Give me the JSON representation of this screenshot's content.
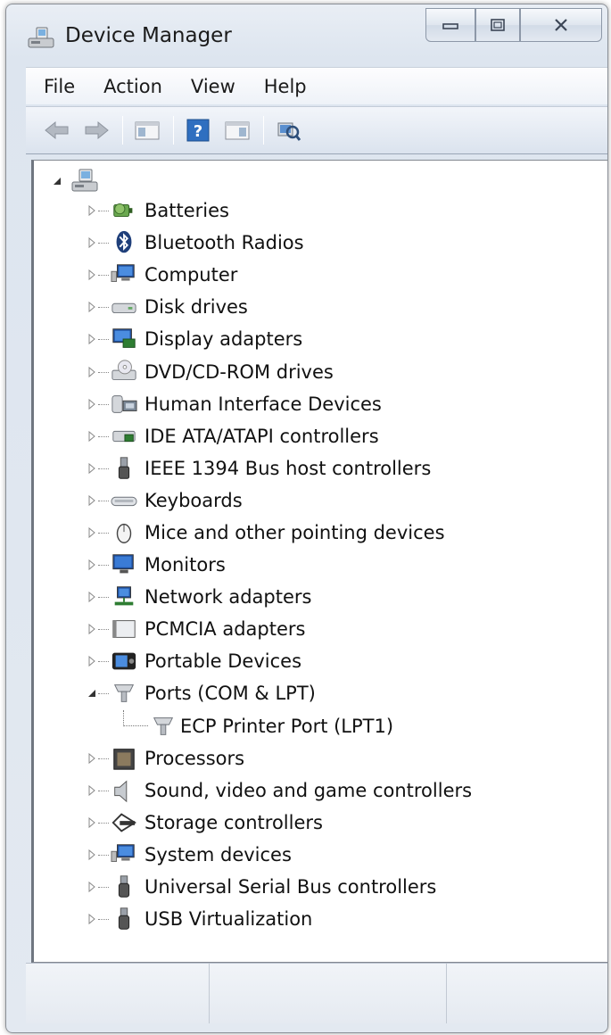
{
  "window": {
    "title": "Device Manager"
  },
  "caption_buttons": {
    "minimize": "▭",
    "maximize": "◫",
    "close": "✕"
  },
  "menu": [
    "File",
    "Action",
    "View",
    "Help"
  ],
  "toolbar": {
    "buttons": [
      "back-arrow-icon",
      "forward-arrow-icon",
      "show-hide-console-tree-icon",
      "help-icon",
      "action-pane-icon",
      "scan-hardware-icon"
    ]
  },
  "tree": {
    "root_icon": "computer-root-icon",
    "categories": [
      {
        "label": "Batteries",
        "icon": "battery-icon",
        "expanded": false
      },
      {
        "label": "Bluetooth Radios",
        "icon": "bluetooth-icon",
        "expanded": false
      },
      {
        "label": "Computer",
        "icon": "computer-icon",
        "expanded": false
      },
      {
        "label": "Disk drives",
        "icon": "disk-drive-icon",
        "expanded": false
      },
      {
        "label": "Display adapters",
        "icon": "display-adapter-icon",
        "expanded": false
      },
      {
        "label": "DVD/CD-ROM drives",
        "icon": "dvd-drive-icon",
        "expanded": false
      },
      {
        "label": "Human Interface Devices",
        "icon": "hid-icon",
        "expanded": false
      },
      {
        "label": "IDE ATA/ATAPI controllers",
        "icon": "ide-controller-icon",
        "expanded": false
      },
      {
        "label": "IEEE 1394 Bus host controllers",
        "icon": "ieee1394-icon",
        "expanded": false
      },
      {
        "label": "Keyboards",
        "icon": "keyboard-icon",
        "expanded": false
      },
      {
        "label": "Mice and other pointing devices",
        "icon": "mouse-icon",
        "expanded": false
      },
      {
        "label": "Monitors",
        "icon": "monitor-icon",
        "expanded": false
      },
      {
        "label": "Network adapters",
        "icon": "network-adapter-icon",
        "expanded": false
      },
      {
        "label": "PCMCIA adapters",
        "icon": "pcmcia-icon",
        "expanded": false
      },
      {
        "label": "Portable Devices",
        "icon": "portable-device-icon",
        "expanded": false
      },
      {
        "label": "Ports (COM & LPT)",
        "icon": "port-icon",
        "expanded": true,
        "children": [
          {
            "label": "ECP Printer Port (LPT1)",
            "icon": "port-icon"
          }
        ]
      },
      {
        "label": "Processors",
        "icon": "processor-icon",
        "expanded": false
      },
      {
        "label": "Sound, video and game controllers",
        "icon": "speaker-icon",
        "expanded": false
      },
      {
        "label": "Storage controllers",
        "icon": "storage-controller-icon",
        "expanded": false
      },
      {
        "label": "System devices",
        "icon": "system-device-icon",
        "expanded": false
      },
      {
        "label": "Universal Serial Bus controllers",
        "icon": "usb-icon",
        "expanded": false
      },
      {
        "label": "USB Virtualization",
        "icon": "usb-icon",
        "expanded": false
      }
    ]
  },
  "colors": {
    "accent": "#2f6fc0",
    "titlebar": "#dde5ef",
    "panel": "#ffffff"
  }
}
